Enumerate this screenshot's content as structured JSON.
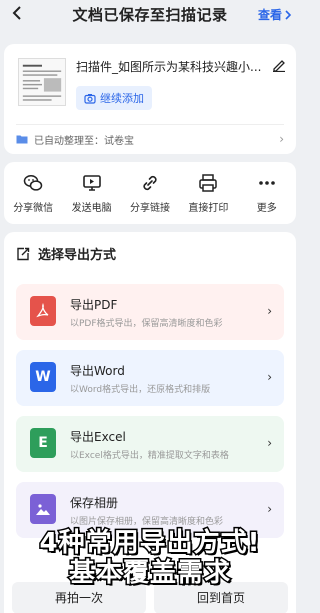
{
  "header": {
    "title": "文档已保存至扫描记录",
    "view_label": "查看"
  },
  "file": {
    "name": "扫描件_如图所示为某科技兴趣小...",
    "add_label": "继续添加",
    "auto_sort_text": "已自动整理至：试卷宝"
  },
  "actions": [
    {
      "label": "分享微信",
      "icon": "wechat-icon"
    },
    {
      "label": "发送电脑",
      "icon": "computer-icon"
    },
    {
      "label": "分享链接",
      "icon": "link-icon"
    },
    {
      "label": "直接打印",
      "icon": "printer-icon"
    },
    {
      "label": "更多",
      "icon": "more-icon"
    }
  ],
  "export": {
    "title": "选择导出方式",
    "options": [
      {
        "name": "导出PDF",
        "desc": "以PDF格式导出，保留高清晰度和色彩",
        "icon": "pdf-icon",
        "color": "#e5534b"
      },
      {
        "name": "导出Word",
        "desc": "以Word格式导出，还原格式和排版",
        "icon": "word-icon",
        "color": "#2b66e8"
      },
      {
        "name": "导出Excel",
        "desc": "以Excel格式导出，精准提取文字和表格",
        "icon": "excel-icon",
        "color": "#2e9e5b"
      },
      {
        "name": "保存相册",
        "desc": "以图片保存相册，保留高清晰度和色彩",
        "icon": "album-icon",
        "color": "#7b61d6"
      }
    ]
  },
  "bottom": {
    "again_label": "再拍一次",
    "home_label": "回到首页"
  },
  "caption": {
    "line1": "4种常用导出方式!",
    "line2": "基本覆盖需求"
  }
}
